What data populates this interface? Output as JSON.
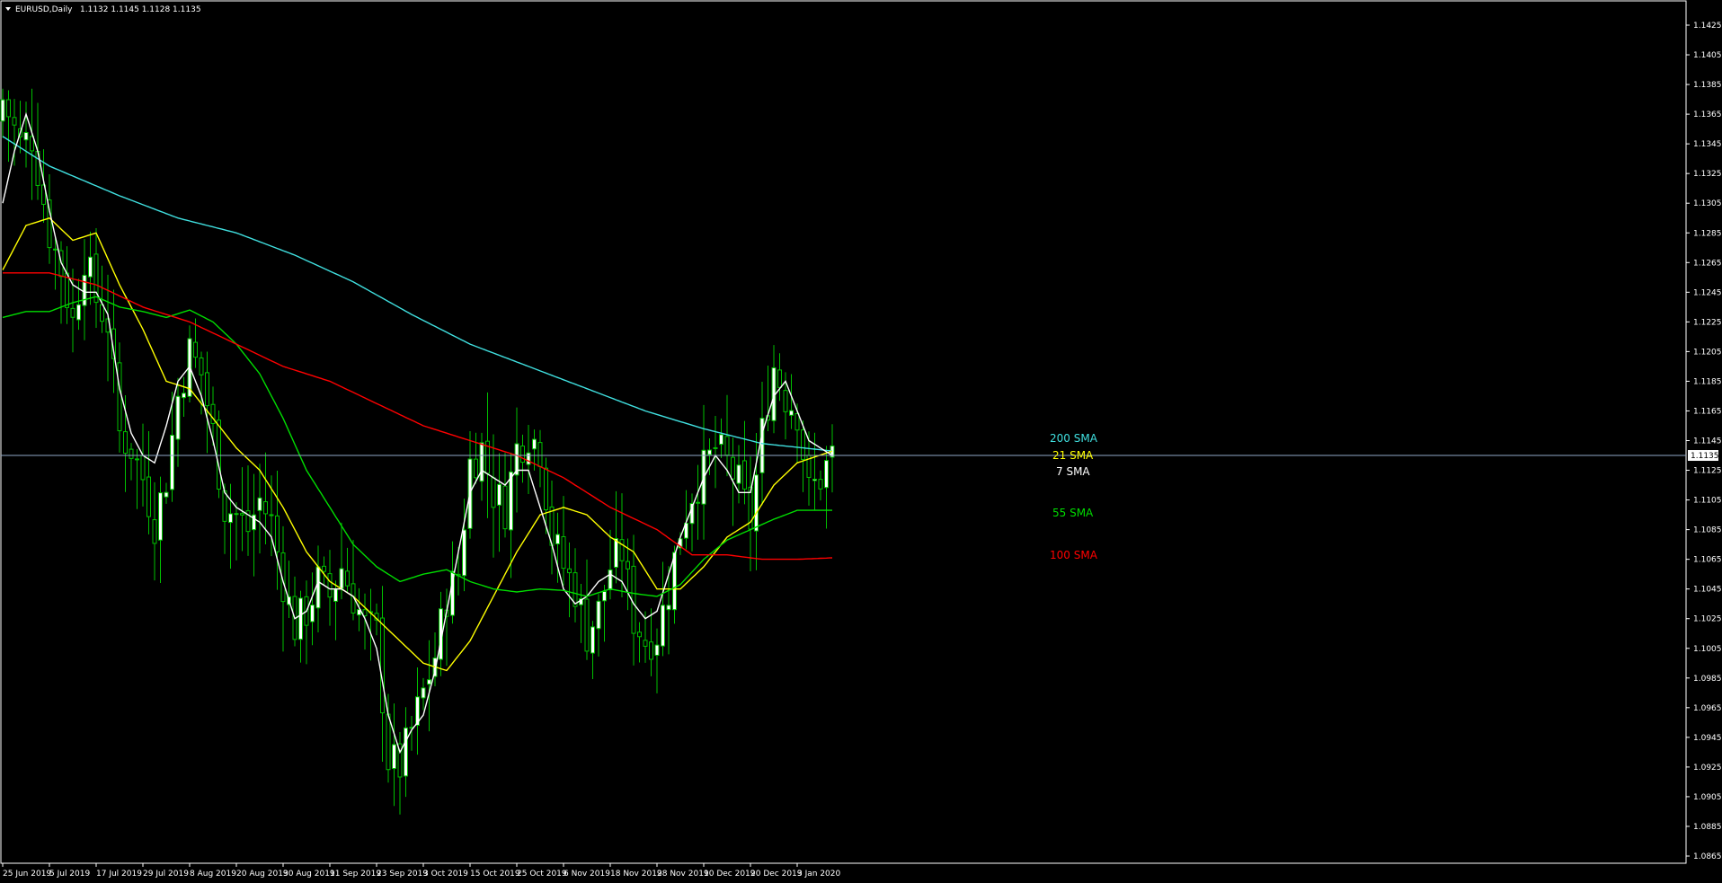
{
  "header": {
    "symbol": "EURUSD,Daily",
    "ohlc": "1.1132 1.1145 1.1128 1.1135"
  },
  "colors": {
    "background": "#000000",
    "frame": "#ffffff",
    "bull": "#ffffff",
    "wick": "#00c000",
    "bear_fill": "#000000",
    "bull_fill": "#ffffff",
    "price_line": "#8fa9c8",
    "sma200": "#40e0e0",
    "sma21": "#ffff00",
    "sma7": "#ffffff",
    "sma55": "#00dd00",
    "sma100": "#ff0000"
  },
  "price_label": "1.1135",
  "chart_data": {
    "type": "candlestick",
    "instrument": "EURUSD",
    "timeframe": "Daily",
    "ylim": [
      1.0865,
      1.1425
    ],
    "yticks": [
      "1.1425",
      "1.1405",
      "1.1385",
      "1.1365",
      "1.1345",
      "1.1325",
      "1.1305",
      "1.1285",
      "1.1265",
      "1.1245",
      "1.1225",
      "1.1205",
      "1.1185",
      "1.1165",
      "1.1145",
      "1.1125",
      "1.1105",
      "1.1085",
      "1.1065",
      "1.1045",
      "1.1025",
      "1.1005",
      "1.0985",
      "1.0965",
      "1.0945",
      "1.0925",
      "1.0905",
      "1.0885",
      "1.0865"
    ],
    "xticks": [
      {
        "label": "25 Jun 2019",
        "bar": 0
      },
      {
        "label": "5 Jul 2019",
        "bar": 8
      },
      {
        "label": "17 Jul 2019",
        "bar": 16
      },
      {
        "label": "29 Jul 2019",
        "bar": 24
      },
      {
        "label": "8 Aug 2019",
        "bar": 32
      },
      {
        "label": "20 Aug 2019",
        "bar": 40
      },
      {
        "label": "30 Aug 2019",
        "bar": 48
      },
      {
        "label": "11 Sep 2019",
        "bar": 56
      },
      {
        "label": "23 Sep 2019",
        "bar": 64
      },
      {
        "label": "3 Oct 2019",
        "bar": 72
      },
      {
        "label": "15 Oct 2019",
        "bar": 80
      },
      {
        "label": "25 Oct 2019",
        "bar": 88
      },
      {
        "label": "6 Nov 2019",
        "bar": 96
      },
      {
        "label": "18 Nov 2019",
        "bar": 104
      },
      {
        "label": "28 Nov 2019",
        "bar": 112
      },
      {
        "label": "10 Dec 2019",
        "bar": 120
      },
      {
        "label": "20 Dec 2019",
        "bar": 128
      },
      {
        "label": "3 Jan 2020",
        "bar": 136
      }
    ],
    "close_anchors": [
      [
        0,
        1.1375
      ],
      [
        3,
        1.1345
      ],
      [
        5,
        1.135
      ],
      [
        8,
        1.1285
      ],
      [
        10,
        1.126
      ],
      [
        12,
        1.1225
      ],
      [
        14,
        1.127
      ],
      [
        16,
        1.124
      ],
      [
        18,
        1.1225
      ],
      [
        20,
        1.115
      ],
      [
        22,
        1.114
      ],
      [
        24,
        1.112
      ],
      [
        26,
        1.109
      ],
      [
        28,
        1.112
      ],
      [
        30,
        1.1175
      ],
      [
        32,
        1.1205
      ],
      [
        34,
        1.119
      ],
      [
        36,
        1.115
      ],
      [
        38,
        1.11
      ],
      [
        40,
        1.1095
      ],
      [
        42,
        1.1085
      ],
      [
        44,
        1.1105
      ],
      [
        46,
        1.109
      ],
      [
        48,
        1.105
      ],
      [
        50,
        1.102
      ],
      [
        52,
        1.103
      ],
      [
        54,
        1.105
      ],
      [
        56,
        1.104
      ],
      [
        58,
        1.106
      ],
      [
        60,
        1.104
      ],
      [
        62,
        1.102
      ],
      [
        64,
        1.1015
      ],
      [
        66,
        1.093
      ],
      [
        68,
        1.0925
      ],
      [
        70,
        1.095
      ],
      [
        72,
        1.0975
      ],
      [
        74,
        1.1
      ],
      [
        76,
        1.104
      ],
      [
        78,
        1.1055
      ],
      [
        80,
        1.113
      ],
      [
        82,
        1.114
      ],
      [
        84,
        1.111
      ],
      [
        86,
        1.11
      ],
      [
        88,
        1.114
      ],
      [
        90,
        1.115
      ],
      [
        92,
        1.114
      ],
      [
        94,
        1.108
      ],
      [
        96,
        1.106
      ],
      [
        98,
        1.1045
      ],
      [
        100,
        1.1015
      ],
      [
        102,
        1.103
      ],
      [
        104,
        1.106
      ],
      [
        106,
        1.107
      ],
      [
        108,
        1.1025
      ],
      [
        110,
        1.101
      ],
      [
        112,
        1.1015
      ],
      [
        114,
        1.1045
      ],
      [
        116,
        1.1085
      ],
      [
        118,
        1.111
      ],
      [
        120,
        1.1125
      ],
      [
        122,
        1.114
      ],
      [
        124,
        1.113
      ],
      [
        126,
        1.1115
      ],
      [
        128,
        1.109
      ],
      [
        130,
        1.115
      ],
      [
        132,
        1.1195
      ],
      [
        134,
        1.1175
      ],
      [
        136,
        1.1165
      ],
      [
        138,
        1.111
      ],
      [
        140,
        1.112
      ],
      [
        142,
        1.1135
      ]
    ],
    "series": [
      {
        "name": "200 SMA",
        "color": "#40e0e0",
        "points": [
          [
            0,
            1.135
          ],
          [
            8,
            1.133
          ],
          [
            20,
            1.131
          ],
          [
            30,
            1.1295
          ],
          [
            40,
            1.1285
          ],
          [
            50,
            1.127
          ],
          [
            60,
            1.1252
          ],
          [
            70,
            1.123
          ],
          [
            80,
            1.121
          ],
          [
            90,
            1.1195
          ],
          [
            100,
            1.118
          ],
          [
            110,
            1.1165
          ],
          [
            120,
            1.1153
          ],
          [
            130,
            1.1143
          ],
          [
            142,
            1.1138
          ]
        ]
      },
      {
        "name": "21 SMA",
        "color": "#ffff00",
        "points": [
          [
            0,
            1.126
          ],
          [
            4,
            1.129
          ],
          [
            8,
            1.1295
          ],
          [
            12,
            1.128
          ],
          [
            16,
            1.1285
          ],
          [
            20,
            1.125
          ],
          [
            24,
            1.122
          ],
          [
            28,
            1.1185
          ],
          [
            32,
            1.118
          ],
          [
            36,
            1.116
          ],
          [
            40,
            1.114
          ],
          [
            44,
            1.1125
          ],
          [
            48,
            1.11
          ],
          [
            52,
            1.107
          ],
          [
            56,
            1.105
          ],
          [
            60,
            1.104
          ],
          [
            64,
            1.1025
          ],
          [
            68,
            1.101
          ],
          [
            72,
            1.0995
          ],
          [
            76,
            1.099
          ],
          [
            80,
            1.101
          ],
          [
            84,
            1.104
          ],
          [
            88,
            1.107
          ],
          [
            92,
            1.1095
          ],
          [
            96,
            1.11
          ],
          [
            100,
            1.1095
          ],
          [
            104,
            1.108
          ],
          [
            108,
            1.107
          ],
          [
            112,
            1.1045
          ],
          [
            116,
            1.1045
          ],
          [
            120,
            1.106
          ],
          [
            124,
            1.108
          ],
          [
            128,
            1.109
          ],
          [
            132,
            1.1115
          ],
          [
            136,
            1.113
          ],
          [
            142,
            1.1138
          ]
        ]
      },
      {
        "name": "7 SMA",
        "color": "#ffffff",
        "points": [
          [
            0,
            1.1305
          ],
          [
            2,
            1.134
          ],
          [
            4,
            1.1365
          ],
          [
            6,
            1.134
          ],
          [
            8,
            1.13
          ],
          [
            10,
            1.1265
          ],
          [
            12,
            1.125
          ],
          [
            14,
            1.1245
          ],
          [
            16,
            1.1245
          ],
          [
            18,
            1.123
          ],
          [
            20,
            1.118
          ],
          [
            22,
            1.115
          ],
          [
            24,
            1.1135
          ],
          [
            26,
            1.113
          ],
          [
            28,
            1.1155
          ],
          [
            30,
            1.1185
          ],
          [
            32,
            1.1195
          ],
          [
            34,
            1.1175
          ],
          [
            36,
            1.1145
          ],
          [
            38,
            1.111
          ],
          [
            40,
            1.11
          ],
          [
            42,
            1.1095
          ],
          [
            44,
            1.109
          ],
          [
            46,
            1.108
          ],
          [
            48,
            1.105
          ],
          [
            50,
            1.1025
          ],
          [
            52,
            1.103
          ],
          [
            54,
            1.105
          ],
          [
            56,
            1.1045
          ],
          [
            58,
            1.1045
          ],
          [
            60,
            1.104
          ],
          [
            62,
            1.1025
          ],
          [
            64,
            1.1005
          ],
          [
            66,
            1.096
          ],
          [
            68,
            1.0935
          ],
          [
            70,
            1.095
          ],
          [
            72,
            1.096
          ],
          [
            74,
            1.099
          ],
          [
            76,
            1.103
          ],
          [
            78,
            1.107
          ],
          [
            80,
            1.111
          ],
          [
            82,
            1.1125
          ],
          [
            84,
            1.112
          ],
          [
            86,
            1.1115
          ],
          [
            88,
            1.1125
          ],
          [
            90,
            1.1125
          ],
          [
            92,
            1.11
          ],
          [
            94,
            1.1075
          ],
          [
            96,
            1.1045
          ],
          [
            98,
            1.1035
          ],
          [
            100,
            1.104
          ],
          [
            102,
            1.105
          ],
          [
            104,
            1.1055
          ],
          [
            106,
            1.105
          ],
          [
            108,
            1.1035
          ],
          [
            110,
            1.1025
          ],
          [
            112,
            1.103
          ],
          [
            114,
            1.1055
          ],
          [
            116,
            1.108
          ],
          [
            118,
            1.11
          ],
          [
            120,
            1.112
          ],
          [
            122,
            1.1135
          ],
          [
            124,
            1.1125
          ],
          [
            126,
            1.111
          ],
          [
            128,
            1.111
          ],
          [
            130,
            1.115
          ],
          [
            132,
            1.1175
          ],
          [
            134,
            1.1185
          ],
          [
            136,
            1.1165
          ],
          [
            138,
            1.1145
          ],
          [
            140,
            1.114
          ],
          [
            142,
            1.1135
          ]
        ]
      },
      {
        "name": "55 SMA",
        "color": "#00dd00",
        "points": [
          [
            0,
            1.1228
          ],
          [
            4,
            1.1232
          ],
          [
            8,
            1.1232
          ],
          [
            12,
            1.1238
          ],
          [
            16,
            1.1242
          ],
          [
            20,
            1.1235
          ],
          [
            24,
            1.1232
          ],
          [
            28,
            1.1228
          ],
          [
            32,
            1.1233
          ],
          [
            36,
            1.1225
          ],
          [
            40,
            1.121
          ],
          [
            44,
            1.119
          ],
          [
            48,
            1.116
          ],
          [
            52,
            1.1125
          ],
          [
            56,
            1.11
          ],
          [
            60,
            1.1075
          ],
          [
            64,
            1.106
          ],
          [
            68,
            1.105
          ],
          [
            72,
            1.1055
          ],
          [
            76,
            1.1058
          ],
          [
            80,
            1.105
          ],
          [
            84,
            1.1045
          ],
          [
            88,
            1.1043
          ],
          [
            92,
            1.1045
          ],
          [
            96,
            1.1044
          ],
          [
            100,
            1.104
          ],
          [
            104,
            1.1045
          ],
          [
            108,
            1.1042
          ],
          [
            112,
            1.104
          ],
          [
            116,
            1.1048
          ],
          [
            120,
            1.1065
          ],
          [
            124,
            1.1078
          ],
          [
            128,
            1.1085
          ],
          [
            132,
            1.1092
          ],
          [
            136,
            1.1098
          ],
          [
            142,
            1.1098
          ]
        ]
      },
      {
        "name": "100 SMA",
        "color": "#ff0000",
        "points": [
          [
            0,
            1.1258
          ],
          [
            8,
            1.1258
          ],
          [
            16,
            1.125
          ],
          [
            24,
            1.1235
          ],
          [
            32,
            1.1225
          ],
          [
            40,
            1.121
          ],
          [
            48,
            1.1195
          ],
          [
            56,
            1.1185
          ],
          [
            64,
            1.117
          ],
          [
            72,
            1.1155
          ],
          [
            80,
            1.1145
          ],
          [
            88,
            1.1135
          ],
          [
            96,
            1.112
          ],
          [
            104,
            1.11
          ],
          [
            112,
            1.1085
          ],
          [
            118,
            1.1068
          ],
          [
            124,
            1.1068
          ],
          [
            130,
            1.1065
          ],
          [
            136,
            1.1065
          ],
          [
            142,
            1.1066
          ]
        ]
      }
    ]
  }
}
